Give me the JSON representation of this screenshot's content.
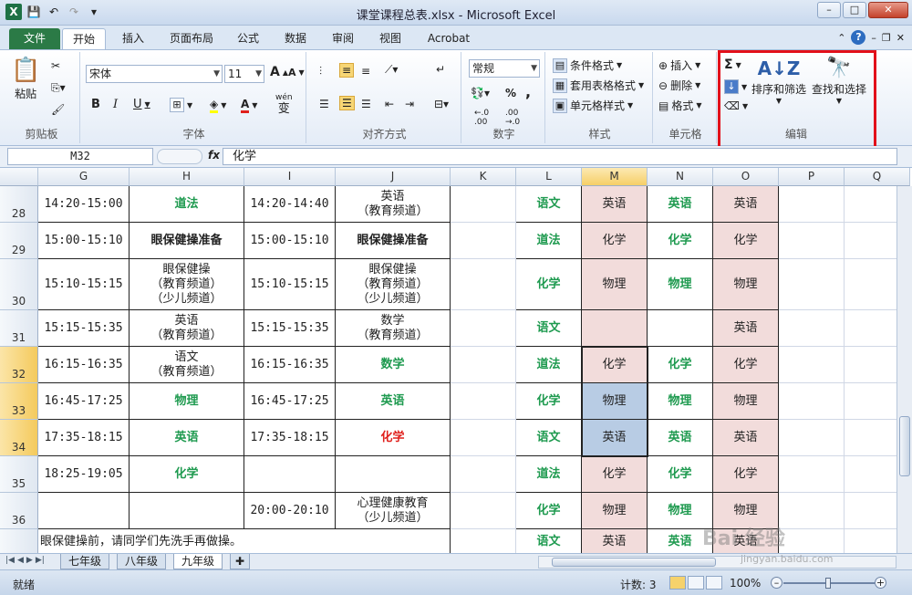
{
  "app": {
    "title": "课堂课程总表.xlsx - Microsoft Excel",
    "logo": "X"
  },
  "tabs": [
    "文件",
    "开始",
    "插入",
    "页面布局",
    "公式",
    "数据",
    "审阅",
    "视图",
    "Acrobat"
  ],
  "ribbon": {
    "clipboard": {
      "paste": "粘贴",
      "label": "剪贴板"
    },
    "font": {
      "name": "宋体",
      "size": "11",
      "grow": "A",
      "shrink": "A",
      "bold": "B",
      "italic": "I",
      "underline": "U",
      "label": "字体",
      "phonetic": "wén"
    },
    "align": {
      "label": "对齐方式"
    },
    "number": {
      "format": "常规",
      "percent": "%",
      "comma": ",",
      "label": "数字"
    },
    "styles": {
      "cond": "条件格式",
      "table": "套用表格格式",
      "cell": "单元格样式",
      "label": "样式"
    },
    "cells": {
      "insert": "插入",
      "delete": "删除",
      "format": "格式",
      "label": "单元格"
    },
    "editing": {
      "sigma": "Σ",
      "sort": "排序和筛选",
      "find": "查找和选择",
      "label": "编辑"
    }
  },
  "formula_bar": {
    "name_box": "M32",
    "fx": "fx",
    "value": "化学"
  },
  "columns": [
    "G",
    "H",
    "I",
    "J",
    "K",
    "L",
    "M",
    "N",
    "O",
    "P",
    "Q"
  ],
  "rows": [
    "28",
    "29",
    "30",
    "31",
    "32",
    "33",
    "34",
    "35",
    "36"
  ],
  "cells": {
    "r28": {
      "G": "14:20-15:00",
      "H": "道法",
      "I": "14:20-14:40",
      "J": "英语\n（教育频道）",
      "L": "语文",
      "M": "英语",
      "N": "英语",
      "O": "英语"
    },
    "r29": {
      "G": "15:00-15:10",
      "H": "眼保健操准备",
      "I": "15:00-15:10",
      "J": "眼保健操准备",
      "L": "道法",
      "M": "化学",
      "N": "化学",
      "O": "化学"
    },
    "r30": {
      "G": "15:10-15:15",
      "H": "眼保健操\n（教育频道）\n（少儿频道）",
      "I": "15:10-15:15",
      "J": "眼保健操\n（教育频道）\n（少儿频道）",
      "L": "化学",
      "M": "物理",
      "N": "物理",
      "O": "物理"
    },
    "r31": {
      "G": "15:15-15:35",
      "H": "英语\n（教育频道）",
      "I": "15:15-15:35",
      "J": "数学\n（教育频道）",
      "L": "语文",
      "M": "",
      "N": "",
      "O": "英语"
    },
    "r32": {
      "G": "16:15-16:35",
      "H": "语文\n（教育频道）",
      "I": "16:15-16:35",
      "J": "数学",
      "L": "道法",
      "M": "化学",
      "N": "化学",
      "O": "化学"
    },
    "r33": {
      "G": "16:45-17:25",
      "H": "物理",
      "I": "16:45-17:25",
      "J": "英语",
      "L": "化学",
      "M": "物理",
      "N": "物理",
      "O": "物理"
    },
    "r34": {
      "G": "17:35-18:15",
      "H": "英语",
      "I": "17:35-18:15",
      "J": "化学",
      "L": "语文",
      "M": "英语",
      "N": "英语",
      "O": "英语"
    },
    "r35": {
      "G": "18:25-19:05",
      "H": "化学",
      "I": "",
      "J": "",
      "L": "道法",
      "M": "化学",
      "N": "化学",
      "O": "化学"
    },
    "r36": {
      "G": "",
      "H": "",
      "I": "20:00-20:10",
      "J": "心理健康教育\n（少儿频道）",
      "L": "化学",
      "M": "物理",
      "N": "物理",
      "O": "物理"
    },
    "r37": {
      "G": "眼保健操前，请同学们先洗手再做操。",
      "L": "语文",
      "M": "英语",
      "N": "英语",
      "O": "英语"
    }
  },
  "sheets": [
    "七年级",
    "八年级",
    "九年级"
  ],
  "status": {
    "ready": "就绪",
    "count": "计数: 3",
    "zoom": "100%"
  },
  "watermark": {
    "main": "Bai 经验",
    "sub": "jingyan.baidu.com"
  }
}
